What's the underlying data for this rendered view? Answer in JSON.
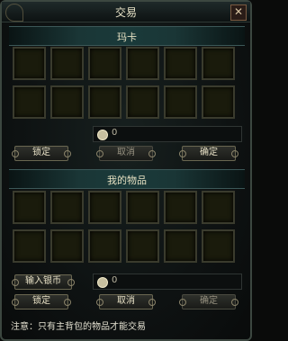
{
  "window": {
    "title": "交易",
    "close": "✕"
  },
  "partner": {
    "name": "玛卡",
    "coins": "0",
    "lock": "锁定",
    "cancel": "取消",
    "confirm": "确定"
  },
  "mine": {
    "title": "我的物品",
    "input_silver": "输入银币",
    "coins": "0",
    "lock": "锁定",
    "cancel": "取消",
    "confirm": "确定"
  },
  "note": "注意：只有主背包的物品才能交易"
}
